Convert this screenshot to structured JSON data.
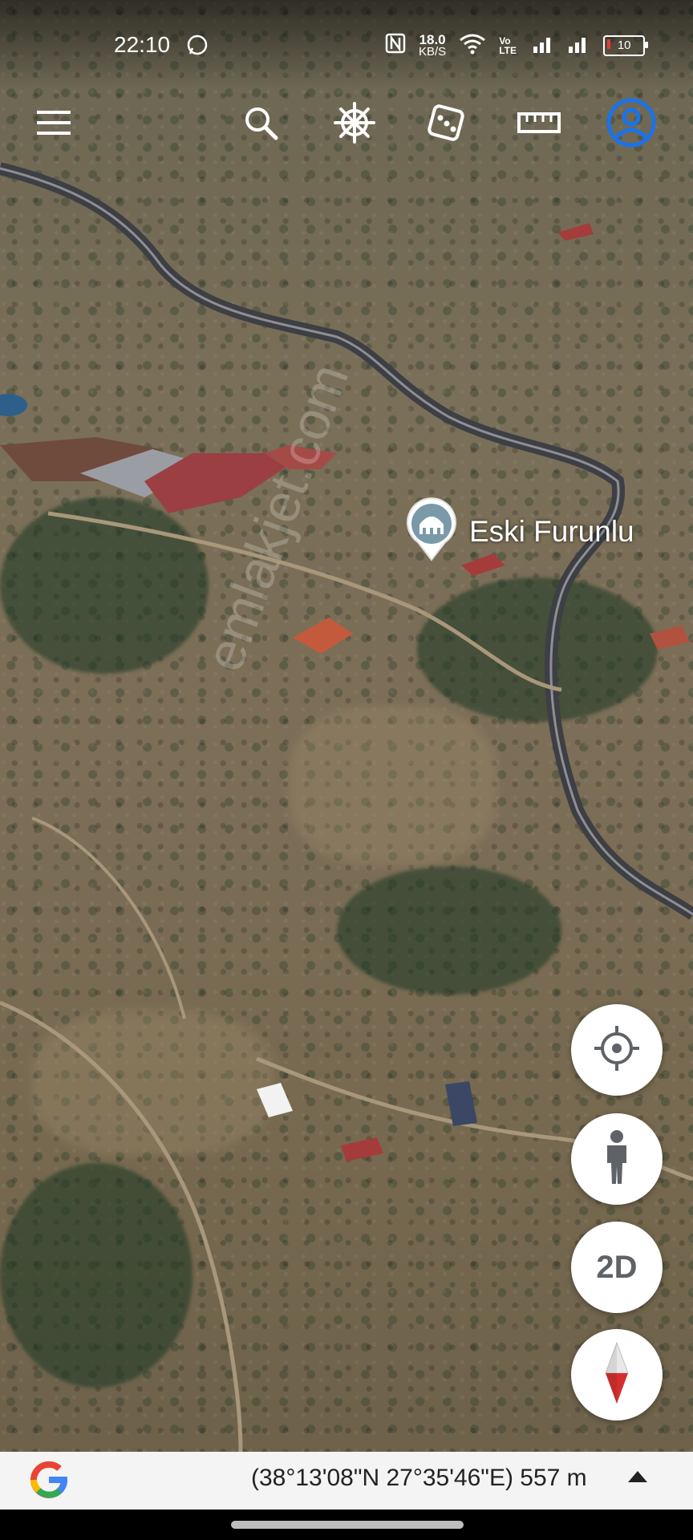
{
  "status_bar": {
    "time": "22:10",
    "net_speed_value": "18.0",
    "net_speed_unit": "KB/S",
    "volte": "Vo LTE",
    "battery_level": "10"
  },
  "toolbar": {
    "icons": [
      "menu-icon",
      "search-icon",
      "voyager-wheel-icon",
      "dice-icon",
      "ruler-icon",
      "account-icon"
    ],
    "accent_color": "#1a73e8"
  },
  "map": {
    "place_label": "Eski Furunlu",
    "place_icon": "mosque-pin-icon",
    "watermark": "emlakjet.com"
  },
  "controls": {
    "mode_2d_label": "2D",
    "icons": [
      "my-location-icon",
      "street-view-person-icon",
      "compass-icon"
    ]
  },
  "bottom_bar": {
    "coordinates": "(38°13'08\"N 27°35'46\"E) 557 m",
    "logo": "google-g-logo"
  }
}
